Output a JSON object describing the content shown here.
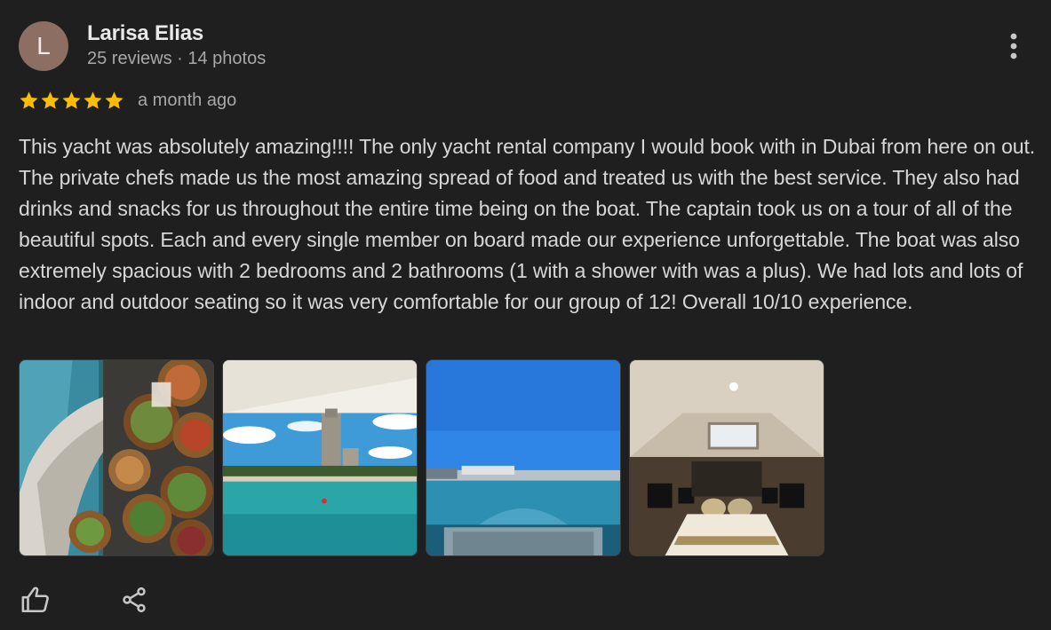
{
  "author": {
    "initial": "L",
    "name": "Larisa Elias",
    "meta": "25 reviews · 14 photos",
    "avatar_color": "#8d6e63"
  },
  "review": {
    "rating": 5,
    "rating_max": 5,
    "star_color": "#fbbc04",
    "date": "a month ago",
    "text": "This yacht was absolutely amazing!!!! The only yacht rental company I would book with in Dubai from here on out. The private chefs made us the most amazing spread of food and treated us with the best service. They also had drinks and snacks for us throughout the entire time being on the boat. The captain took us on a tour of all of the beautiful spots. Each and every single member on board made our experience unforgettable. The boat was also extremely spacious with 2 bedrooms and 2 bathrooms (1 with a shower with was a plus). We had lots and lots of indoor and outdoor seating so it was very comfortable for our group of 12! Overall 10/10 experience."
  },
  "photos": [
    {
      "subject": "food-spread-photo"
    },
    {
      "subject": "city-skyline-photo"
    },
    {
      "subject": "sea-view-photo"
    },
    {
      "subject": "bedroom-photo"
    }
  ],
  "icons": {
    "more": "more-vert-icon",
    "like": "thumb-up-icon",
    "share": "share-icon"
  }
}
